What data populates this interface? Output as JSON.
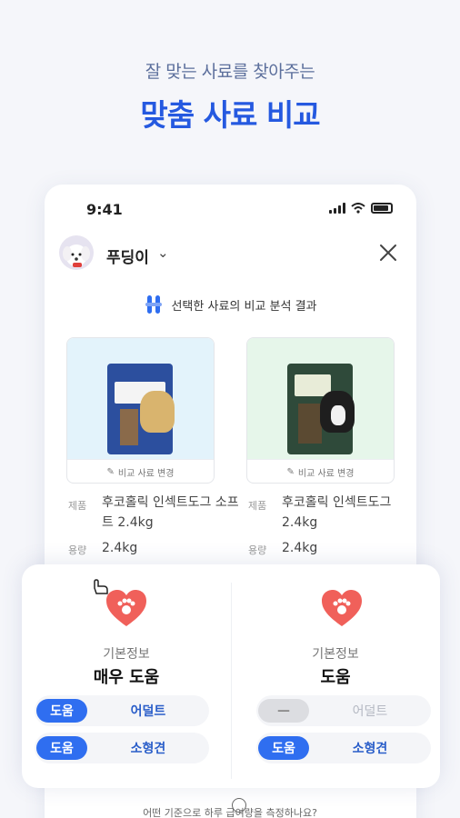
{
  "hero": {
    "subtitle": "잘 맞는 사료를 찾아주는",
    "title": "맞춤 사료 비교"
  },
  "status_bar": {
    "time": "9:41"
  },
  "header": {
    "pet_name": "푸딩이",
    "chevron": "⌄",
    "close_icon": "close-icon"
  },
  "result_title": "선택한 사료의 비교 분석 결과",
  "products": [
    {
      "change_label": "비교 사료 변경",
      "row_labels": [
        "제품",
        "용량"
      ],
      "name": "후코홀릭 인섹트도그 소프트 2.4kg",
      "weight": "2.4kg",
      "bg": "#e3f3fb",
      "bag_color": "#2c4f9e"
    },
    {
      "change_label": "비교 사료 변경",
      "row_labels": [
        "제품",
        "용량"
      ],
      "name": "후코홀릭 인섹트도그 2.4kg",
      "weight": "2.4kg",
      "bg": "#e6f6ea",
      "bag_color": "#2f4a3a"
    }
  ],
  "comparison": [
    {
      "category": "기본정보",
      "verdict": "매우 도움",
      "pills": [
        {
          "tag": "도움",
          "text": "어덜트",
          "active": true
        },
        {
          "tag": "도움",
          "text": "소형견",
          "active": true
        }
      ]
    },
    {
      "category": "기본정보",
      "verdict": "도움",
      "pills": [
        {
          "tag": "—",
          "text": "어덜트",
          "active": false
        },
        {
          "tag": "도움",
          "text": "소형견",
          "active": true
        }
      ]
    }
  ],
  "footer_question": "어떤 기준으로 하루 급여량을 측정하나요?",
  "colors": {
    "accent": "#2f6ef0",
    "hero_title": "#2559e0",
    "heart": "#f0605a"
  }
}
